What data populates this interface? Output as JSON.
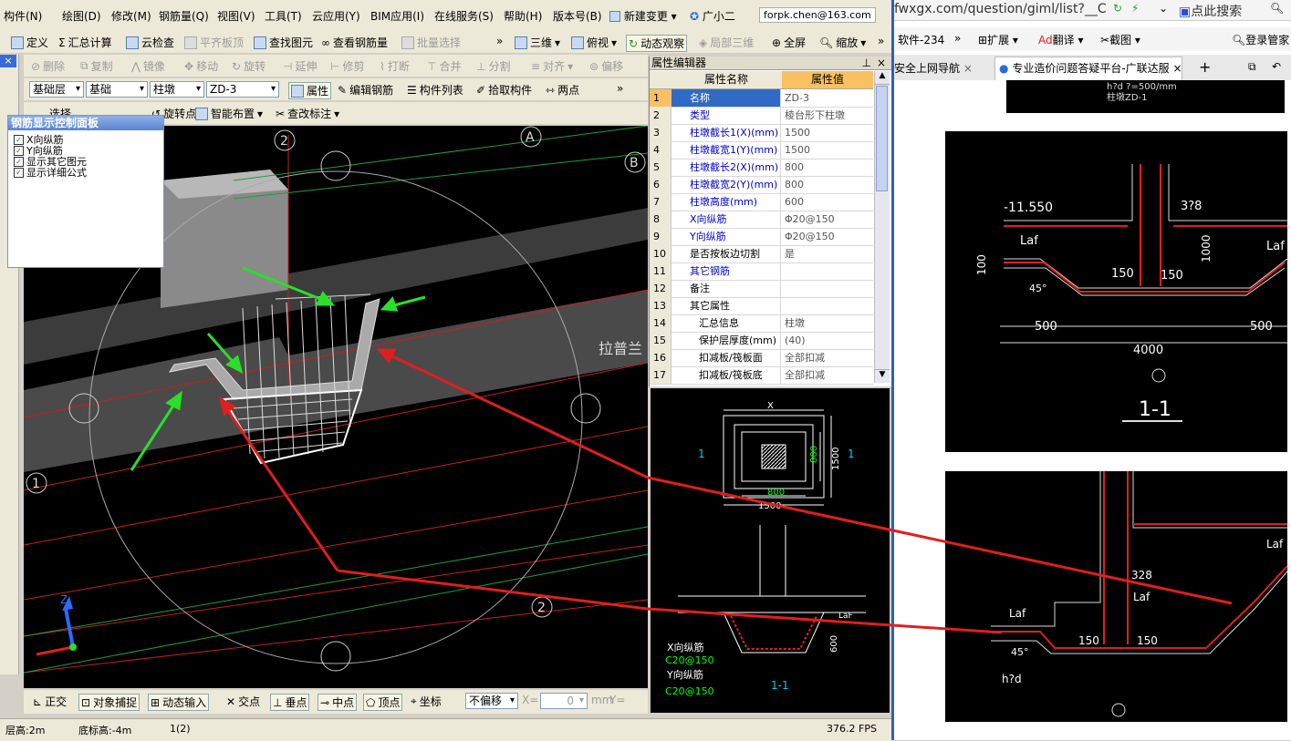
{
  "menu": {
    "items": [
      "构件(N)",
      "绘图(D)",
      "修改(M)",
      "钢筋量(Q)",
      "视图(V)",
      "工具(T)",
      "云应用(Y)",
      "BIM应用(I)",
      "在线服务(S)",
      "帮助(H)",
      "版本号(B)",
      "新建变更",
      "广小二"
    ],
    "user_email": "forpk.chen@163.com"
  },
  "toolbar1": {
    "define": "定义",
    "calc": "汇总计算",
    "cloud_check": "云检查",
    "flat_top": "平齐板顶",
    "find": "查找图元",
    "view_rebar": "查看钢筋量",
    "batch_select": "批量选择",
    "three_d": "三维",
    "top_view": "俯视",
    "dynamic_view": "动态观察",
    "partial_3d": "局部三维",
    "full_screen": "全屏",
    "zoom": "缩放"
  },
  "toolbar2": {
    "delete": "删除",
    "copy": "复制",
    "mirror": "镜像",
    "move": "移动",
    "rotate": "旋转",
    "extend": "延伸",
    "trim": "修剪",
    "break": "打断",
    "merge": "合并",
    "split": "分割",
    "align": "对齐",
    "offset": "偏移"
  },
  "toolbar3": {
    "layer": "基础层",
    "category": "基础",
    "type": "柱墩",
    "name": "ZD-3",
    "properties": "属性",
    "edit_rebar": "编辑钢筋",
    "component_list": "构件列表",
    "pick": "拾取构件",
    "two_points": "两点"
  },
  "toolbar4": {
    "select": "选择",
    "rotate_point": "旋转点",
    "smart_layout": "智能布置",
    "modify_label": "查改标注"
  },
  "rebar_panel": {
    "title": "钢筋显示控制面板",
    "options": [
      "X向纵筋",
      "Y向纵筋",
      "显示其它图元",
      "显示详细公式"
    ]
  },
  "viewport": {
    "axis_labels": [
      "2",
      "A",
      "B",
      "2",
      "1"
    ],
    "floating_text": "拉普兰"
  },
  "property_editor": {
    "title": "属性编辑器",
    "col_name": "属性名称",
    "col_value": "属性值",
    "rows": [
      {
        "n": "1",
        "k": "名称",
        "v": "ZD-3"
      },
      {
        "n": "2",
        "k": "类型",
        "v": "棱台形下柱墩"
      },
      {
        "n": "3",
        "k": "柱墩截长1(X)(mm)",
        "v": "1500"
      },
      {
        "n": "4",
        "k": "柱墩截宽1(Y)(mm)",
        "v": "1500"
      },
      {
        "n": "5",
        "k": "柱墩截长2(X)(mm)",
        "v": "800"
      },
      {
        "n": "6",
        "k": "柱墩截宽2(Y)(mm)",
        "v": "800"
      },
      {
        "n": "7",
        "k": "柱墩高度(mm)",
        "v": "600"
      },
      {
        "n": "8",
        "k": "X向纵筋",
        "v": "Φ20@150"
      },
      {
        "n": "9",
        "k": "Y向纵筋",
        "v": "Φ20@150"
      },
      {
        "n": "10",
        "k": "是否按板边切割",
        "v": "是"
      },
      {
        "n": "11",
        "k": "其它钢筋",
        "v": ""
      },
      {
        "n": "12",
        "k": "备注",
        "v": ""
      },
      {
        "n": "13",
        "k": "其它属性",
        "v": ""
      },
      {
        "n": "14",
        "k": "汇总信息",
        "v": "柱墩"
      },
      {
        "n": "15",
        "k": "保护层厚度(mm)",
        "v": "(40)"
      },
      {
        "n": "16",
        "k": "扣减板/筏板面",
        "v": "全部扣减"
      },
      {
        "n": "17",
        "k": "扣减板/筏板底",
        "v": "全部扣减"
      }
    ]
  },
  "preview": {
    "x_label": "X",
    "dim_800_a": "800",
    "dim_1500_a": "1500",
    "dim_800_b": "800",
    "dim_1500_b": "1500",
    "sec_mark": "1",
    "x_rebar": "X向纵筋",
    "x_spec": "C20@150",
    "y_rebar": "Y向纵筋",
    "y_spec": "C20@150",
    "section": "1-1",
    "dim_600": "600",
    "laf": "LaF"
  },
  "snap_bar": {
    "ortho": "正交",
    "snap": "对象捕捉",
    "dynamic_input": "动态输入",
    "intersection": "交点",
    "perpendicular": "垂点",
    "midpoint": "中点",
    "vertex": "顶点",
    "coordinate": "坐标",
    "offset_mode": "不偏移",
    "x_label": "X=",
    "x_value": "0",
    "unit": "mm",
    "y_label": "Y="
  },
  "status": {
    "floor_height": "层高:2m",
    "base_height": "底标高:-4m",
    "count": "1(2)",
    "fps": "376.2 FPS"
  },
  "browser": {
    "url": "fwxgx.com/question/giml/list?__C",
    "search": "点此搜索",
    "toolbar": [
      "软件-234",
      "扩展",
      "翻译",
      "截图",
      "登录管家"
    ],
    "tabs": [
      "安全上网导航",
      "专业造价问题答疑平台-广联达服"
    ]
  },
  "cad1": {
    "elev": "-11.550",
    "laf1": "Laf",
    "laf2": "Laf",
    "d150a": "150",
    "d150b": "150",
    "d500a": "500",
    "d500b": "500",
    "d4000": "4000",
    "d1000": "1000",
    "d100": "100",
    "d328": "3?8",
    "d45": "45°",
    "section": "1-1"
  },
  "cad2": {
    "laf1": "Laf",
    "laf2": "Laf",
    "laf3": "Laf",
    "d150a": "150",
    "d150b": "150",
    "d328": "328",
    "h": "h?d",
    "d45": "45°"
  },
  "cad_top": {
    "line1": "h?d ?=500/mm",
    "line2": "柱墩ZD-1"
  }
}
